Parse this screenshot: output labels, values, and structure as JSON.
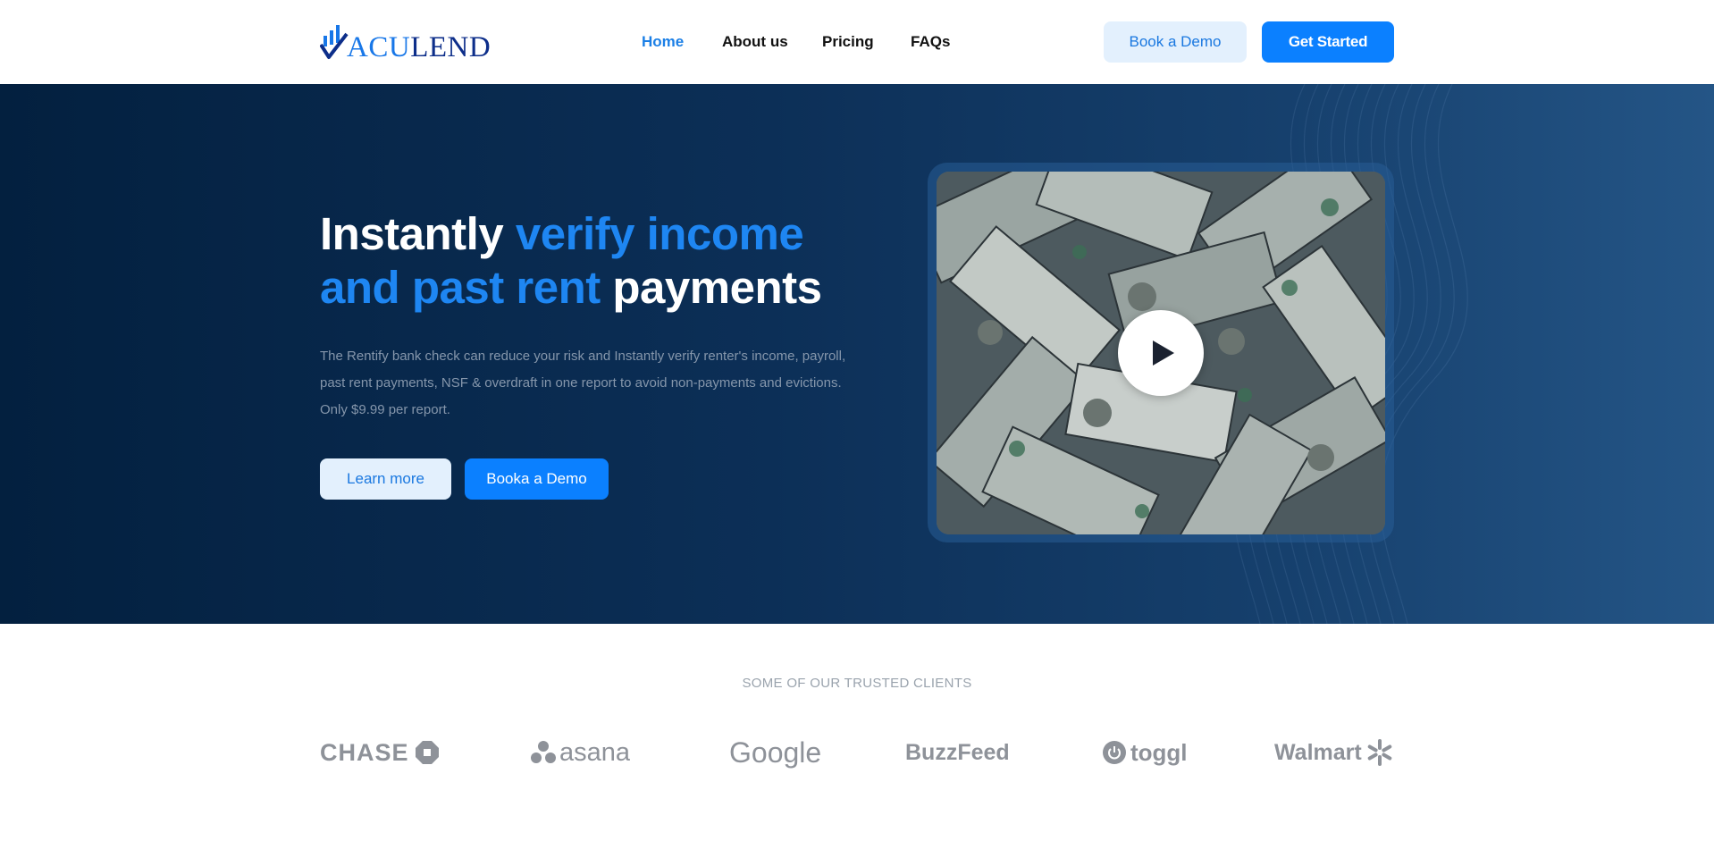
{
  "brand": {
    "logo_text_1": "ACU",
    "logo_text_2": "LEND",
    "logo_icon": "check-chart-icon"
  },
  "nav": {
    "items": [
      {
        "label": "Home",
        "active": true
      },
      {
        "label": "About us",
        "active": false
      },
      {
        "label": "Pricing",
        "active": false
      },
      {
        "label": "FAQs",
        "active": false
      }
    ]
  },
  "header_actions": {
    "demo_label": "Book a Demo",
    "start_label": "Get Started"
  },
  "hero": {
    "headline_1": "Instantly ",
    "headline_highlight": "verify income and past rent",
    "headline_2": " payments",
    "description": "The Rentify bank check can reduce your risk and Instantly verify renter's income, payroll, past rent payments, NSF & overdraft in one report to avoid non-payments and evictions. Only $9.99 per report.",
    "learn_label": "Learn more",
    "demo_label": "Booka a Demo",
    "video_icon": "play-icon"
  },
  "clients": {
    "title": "SOME OF OUR TRUSTED CLIENTS",
    "logos": [
      "CHASE",
      "asana",
      "Google",
      "BuzzFeed",
      "toggl",
      "Walmart"
    ]
  },
  "colors": {
    "accent": "#0b80ff",
    "accent_light": "#e3f0fd",
    "hero_dark": "#03203f",
    "hero_light": "#245586",
    "logo_grey": "#8e9299"
  }
}
